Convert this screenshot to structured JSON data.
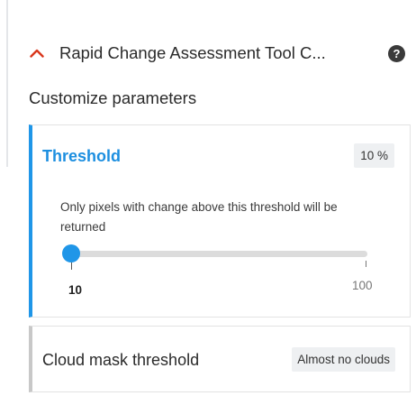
{
  "header": {
    "title": "Rapid Change Assessment Tool C...",
    "help_symbol": "?",
    "collapse_icon": "chevron-up-icon",
    "accent_color": "#d9371c"
  },
  "section": {
    "title": "Customize parameters"
  },
  "threshold": {
    "title": "Threshold",
    "value_display": "10 %",
    "description": "Only pixels with change above this threshold will be returned",
    "min_label": "10",
    "max_label": "100",
    "current_value": 10,
    "accent_color": "#1f96e8"
  },
  "cloud_mask": {
    "title": "Cloud mask threshold",
    "value_display": "Almost no clouds"
  }
}
